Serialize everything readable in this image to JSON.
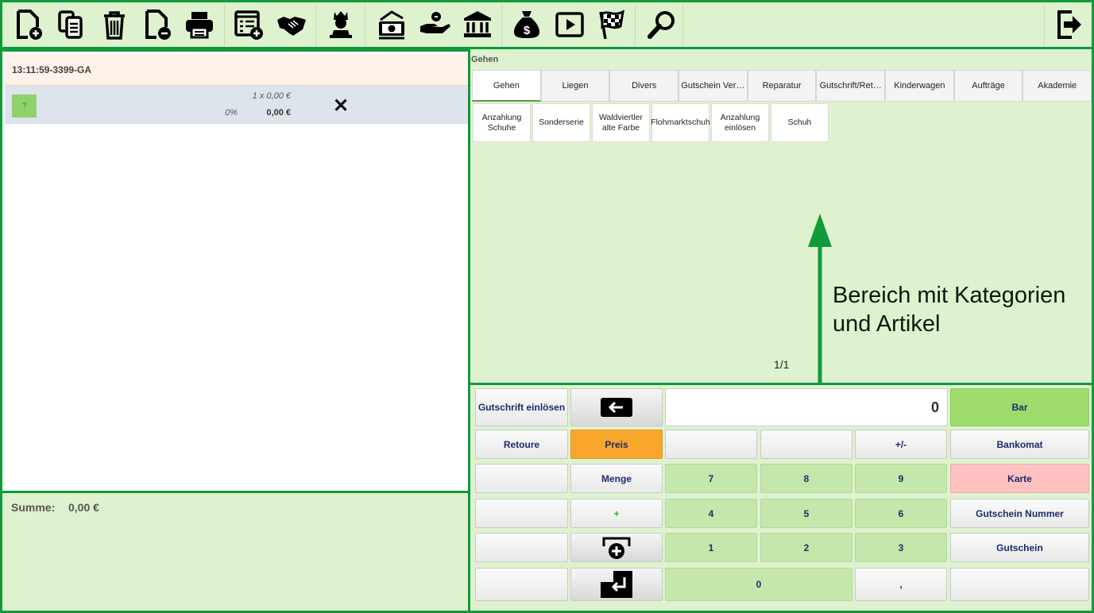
{
  "toolbar": {
    "buttons": [
      {
        "name": "new-document-icon"
      },
      {
        "name": "copy-document-icon"
      },
      {
        "name": "trash-icon"
      },
      {
        "name": "remove-document-icon"
      },
      {
        "name": "print-icon"
      },
      {
        "name": "add-list-icon"
      },
      {
        "name": "handshake-icon"
      },
      {
        "name": "chess-king-icon"
      },
      {
        "name": "cash-register-icon"
      },
      {
        "name": "hand-coin-icon"
      },
      {
        "name": "bank-icon"
      },
      {
        "name": "money-bag-icon"
      },
      {
        "name": "play-icon"
      },
      {
        "name": "checkered-flag-icon"
      },
      {
        "name": "search-icon"
      },
      {
        "name": "logout-icon"
      }
    ]
  },
  "document": {
    "id": "13:11:59-3399-GA",
    "item": {
      "badge": "?",
      "qty": "1 x 0,00 €",
      "discount": "0%",
      "total": "0,00 €",
      "delete": "✕"
    }
  },
  "summary": {
    "label": "Summe:",
    "value": "0,00 €"
  },
  "category_panel": {
    "title": "Gehen",
    "tabs": [
      "Gehen",
      "Liegen",
      "Divers",
      "Gutschein Ver…",
      "Reparatur",
      "Gutschrift/Ret…",
      "Kinderwagen",
      "Aufträge",
      "Akademie"
    ],
    "active_tab": 0,
    "articles": [
      "Anzahlung Schuhe",
      "Sonderserie",
      "Waldviertler alte Farbe",
      "Flohmarktschuh",
      "Anzahlung einlösen",
      "Schuh"
    ],
    "pager": "1/1",
    "annotation": "Bereich mit Kategorien und Artikel"
  },
  "keypad": {
    "display": "0",
    "gutschrift": "Gutschrift einlösen",
    "retoure": "Retoure",
    "preis": "Preis",
    "menge": "Menge",
    "plus": "+",
    "plusminus": "+/-",
    "digits": [
      "7",
      "8",
      "9",
      "4",
      "5",
      "6",
      "1",
      "2",
      "3",
      "0"
    ],
    "comma": ",",
    "bar": "Bar",
    "bankomat": "Bankomat",
    "karte": "Karte",
    "gutschein_nummer": "Gutschein Nummer",
    "gutschein": "Gutschein"
  },
  "colors": {
    "frame": "#0f9b3a",
    "panel_bg": "#dff2cf",
    "accent_orange": "#f8a72c",
    "bar_green": "#9ddc6c",
    "karte_pink": "#ffc2c2"
  }
}
